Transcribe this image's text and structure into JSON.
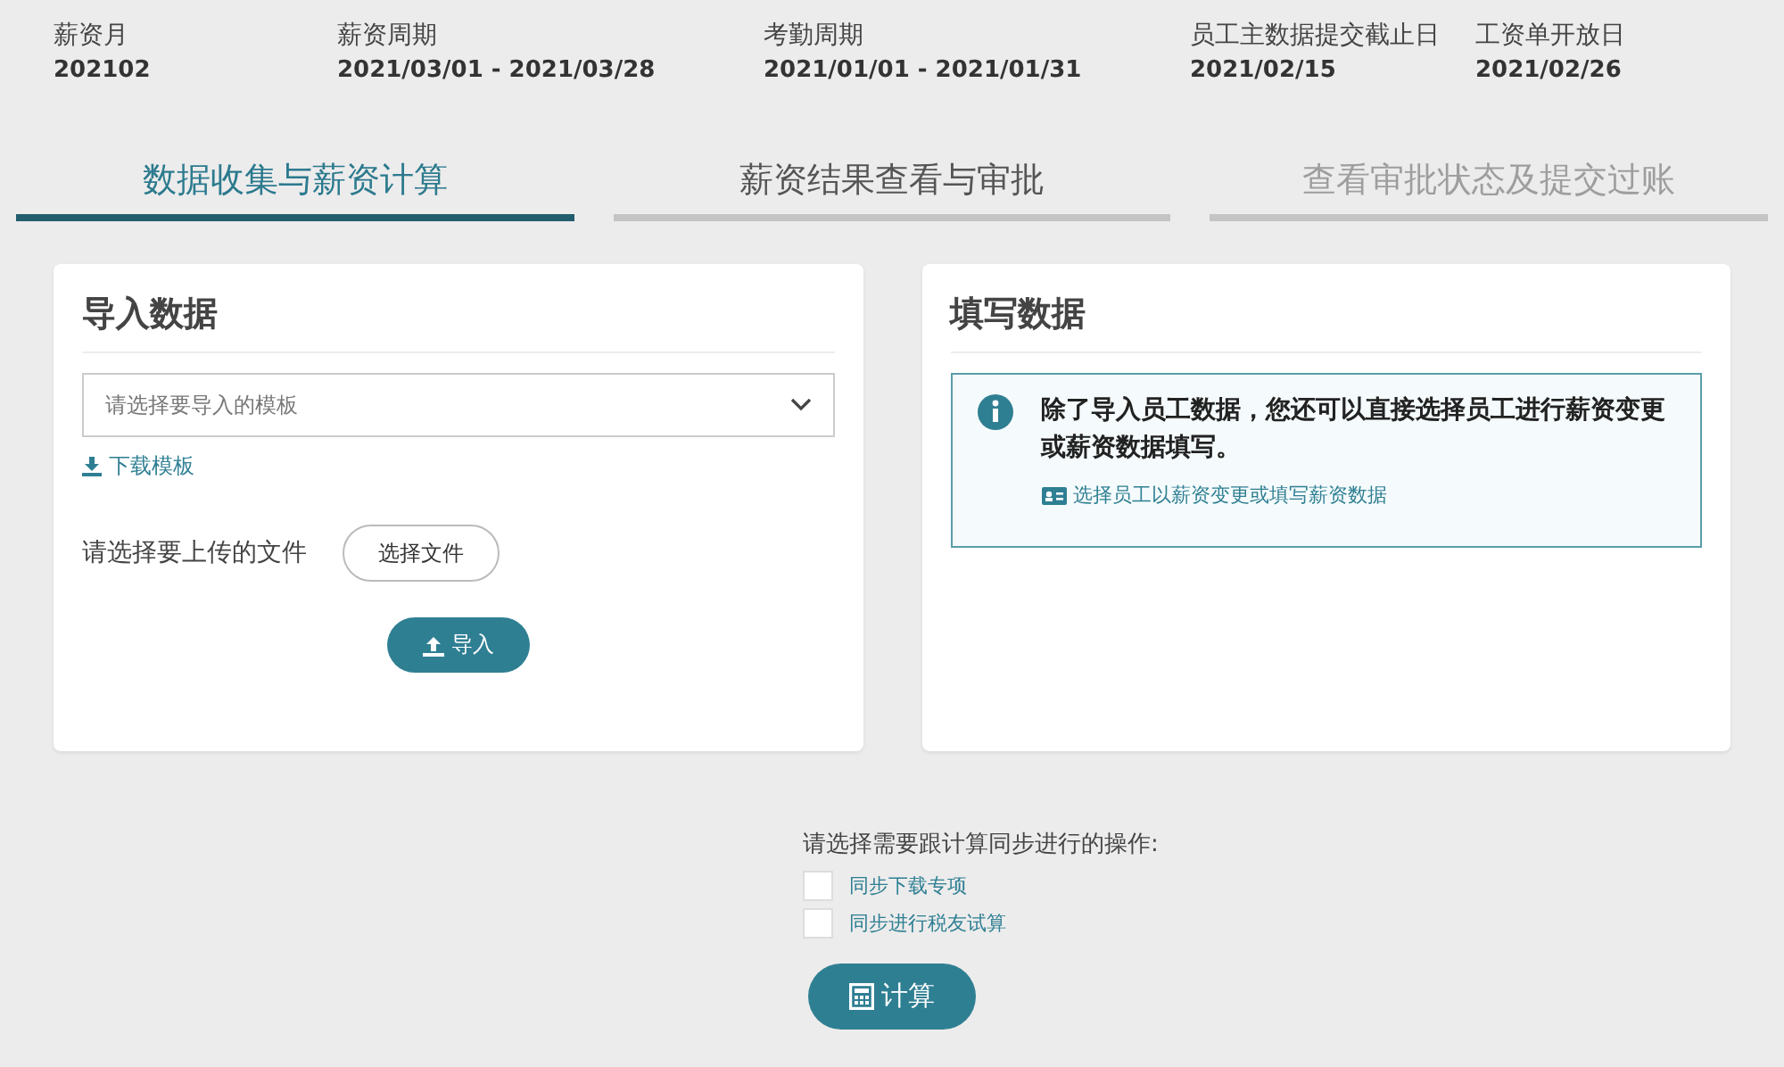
{
  "header": [
    {
      "label": "薪资月",
      "value": "202102"
    },
    {
      "label": "薪资周期",
      "value": "2021/03/01 - 2021/03/28"
    },
    {
      "label": "考勤周期",
      "value": "2021/01/01 - 2021/01/31"
    },
    {
      "label": "员工主数据提交截止日",
      "value": "2021/02/15"
    },
    {
      "label": "工资单开放日",
      "value": "2021/02/26"
    }
  ],
  "tabs": [
    {
      "label": "数据收集与薪资计算",
      "selected": true,
      "disabled": false
    },
    {
      "label": "薪资结果查看与审批",
      "selected": false,
      "disabled": false
    },
    {
      "label": "查看审批状态及提交过账",
      "selected": false,
      "disabled": true
    }
  ],
  "import_card": {
    "title": "导入数据",
    "template_select": {
      "placeholder": "请选择要导入的模板"
    },
    "download_link": "下载模板",
    "upload_label": "请选择要上传的文件",
    "choose_file_button": "选择文件",
    "import_button": "导入"
  },
  "fill_card": {
    "title": "填写数据",
    "info": "除了导入员工数据，您还可以直接选择员工进行薪资变更或薪资数据填写。",
    "link": "选择员工以薪资变更或填写薪资数据"
  },
  "calc": {
    "prompt": "请选择需要跟计算同步进行的操作:",
    "options": [
      {
        "label": "同步下载专项",
        "checked": false
      },
      {
        "label": "同步进行税友试算",
        "checked": false
      }
    ],
    "button": "计算"
  }
}
